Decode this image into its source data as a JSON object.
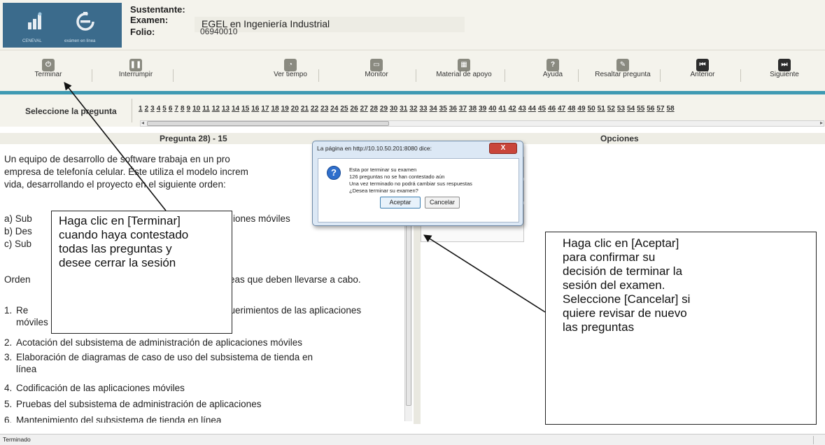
{
  "header": {
    "logo_left_text": "CENEVAL",
    "logo_right_text": "exámen en línea",
    "labels": {
      "sustentante": "Sustentante:",
      "examen": "Examen:",
      "folio": "Folio:"
    },
    "exam_name": "EGEL en Ingeniería Industrial",
    "folio_value": "06940010"
  },
  "toolbar": [
    {
      "label": "Terminar",
      "icon": "power-icon",
      "color": "#8a8a80"
    },
    {
      "label": "Interrumpir",
      "icon": "pause-icon",
      "color": "#8a8a80"
    },
    {
      "label": "Ver tiempo",
      "icon": "clock-icon",
      "color": "#8a8a80"
    },
    {
      "label": "Monitor",
      "icon": "monitor-icon",
      "color": "#8a8a80"
    },
    {
      "label": "Material de apoyo",
      "icon": "calculator-icon",
      "color": "#8a8a80"
    },
    {
      "label": "Ayuda",
      "icon": "help-icon",
      "color": "#8a8a80"
    },
    {
      "label": "Resaltar pregunta",
      "icon": "highlight-icon",
      "color": "#8a8a80"
    },
    {
      "label": "Anterior",
      "icon": "previous-icon",
      "color": "#2c2c2c"
    },
    {
      "label": "Siguiente",
      "icon": "next-icon",
      "color": "#2c2c2c"
    }
  ],
  "selector": {
    "label": "Seleccione la pregunta",
    "numbers": [
      "1",
      "2",
      "3",
      "4",
      "5",
      "6",
      "7",
      "8",
      "9",
      "10",
      "11",
      "12",
      "13",
      "14",
      "15",
      "16",
      "17",
      "18",
      "19",
      "20",
      "21",
      "22",
      "23",
      "24",
      "25",
      "26",
      "27",
      "28",
      "29",
      "30",
      "31",
      "32",
      "33",
      "34",
      "35",
      "36",
      "37",
      "38",
      "39",
      "40",
      "41",
      "42",
      "43",
      "44",
      "45",
      "46",
      "47",
      "48",
      "49",
      "50",
      "51",
      "52",
      "53",
      "54",
      "55",
      "56",
      "57",
      "58"
    ]
  },
  "question_header": "Pregunta 28) - 15",
  "options_header": "Opciones",
  "question": {
    "intro": [
      "Un equipo de desarrollo de software trabaja en un pro",
      "empresa de telefonía celular. Éste utiliza el modelo increm",
      "vida, desarrollando el proyecto en el siguiente orden:"
    ],
    "items": [
      "a) Sub",
      "b) Des",
      "c) Sub"
    ],
    "item_a_tail": "iones móviles",
    "instruction_start": "Orden",
    "instruction_tail": "eas que deben llevarse a cabo.",
    "steps": [
      {
        "num": "1.",
        "lines": [
          "Re",
          "móviles"
        ],
        "tail": "querimientos de las aplicaciones"
      },
      {
        "num": "2.",
        "lines": [
          "Acotación del subsistema de administración de aplicaciones móviles"
        ]
      },
      {
        "num": "3.",
        "lines": [
          "Elaboración de diagramas de caso de uso del subsistema de tienda en",
          "línea"
        ]
      },
      {
        "num": "4.",
        "lines": [
          "Codificación de las aplicaciones móviles"
        ]
      },
      {
        "num": "5.",
        "lines": [
          "Pruebas del subsistema de administración de aplicaciones"
        ]
      },
      {
        "num": "6.",
        "lines": [
          "Mantenimiento del subsistema de tienda en línea"
        ]
      }
    ]
  },
  "callouts": {
    "left": [
      "Haga clic en [Terminar]",
      "cuando haya contestado",
      "todas las preguntas y",
      "desee cerrar la sesión"
    ],
    "right": [
      "Haga clic en [Aceptar]",
      "para confirmar su",
      "decisión de terminar la",
      "sesión del examen.",
      "Seleccione [Cancelar] si",
      "quiere revisar de nuevo",
      "las preguntas"
    ]
  },
  "dialog": {
    "title": "La página en http://10.10.50.201:8080 dice:",
    "close": "X",
    "lines": [
      "Esta por terminar su examen",
      "126 preguntas no se han contestado aún",
      "Una vez terminado no podrá cambiar sus respuestas",
      "¿Desea terminar su examen?"
    ],
    "accept": "Aceptar",
    "cancel": "Cancelar"
  },
  "status_bar": "Terminado",
  "colors": {
    "toolbar_accent": "#3f9ab3",
    "logo_bg": "#3b6b8c",
    "dialog_bg": "#dce8f5"
  }
}
